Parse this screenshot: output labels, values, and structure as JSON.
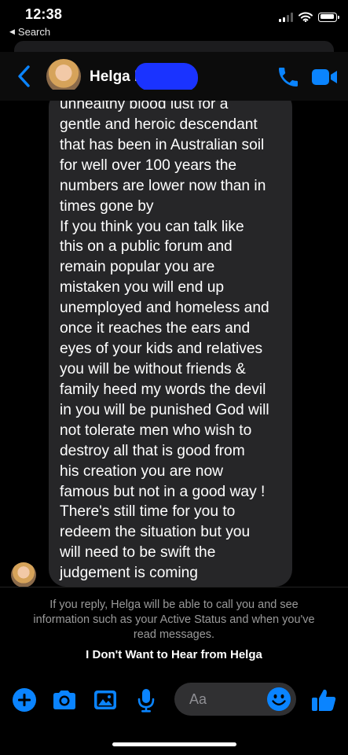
{
  "status_bar": {
    "time": "12:38",
    "back_label": "Search"
  },
  "header": {
    "contact_name": "Helga I"
  },
  "message": {
    "text": "unhealthy blood lust for a\ngentle and heroic descendant\nthat has been in Australian soil\nfor well over 100 years the\nnumbers are lower now than in\ntimes gone by\nIf you think you can talk like\nthis on a public forum and\nremain popular you are\nmistaken you will end up\nunemployed and homeless and\nonce it reaches the ears and\neyes of your kids and relatives\nyou will be without friends &\nfamily heed my words the devil\nin you will be punished God will\nnot tolerate men who wish to\ndestroy all that is good from\nhis creation you are now\nfamous but not in a good way !\nThere's still time for you to\nredeem the situation but you\nwill need to be swift the\njudgement is coming"
  },
  "notice": {
    "text": "If you reply, Helga will be able to call you and see information such as your Active Status and when you've read messages.",
    "action": "I Don't Want to Hear from Helga"
  },
  "composer": {
    "placeholder": "Aa"
  },
  "icons": {
    "back": "chevron-left-icon",
    "call": "phone-icon",
    "video": "video-camera-icon",
    "plus": "plus-circle-icon",
    "camera": "camera-icon",
    "gallery": "photo-icon",
    "mic": "microphone-icon",
    "emoji": "emoji-icon",
    "like": "thumbs-up-icon"
  },
  "colors": {
    "accent": "#0a84ff",
    "bubble": "#262628",
    "redaction": "#1a33ff"
  }
}
